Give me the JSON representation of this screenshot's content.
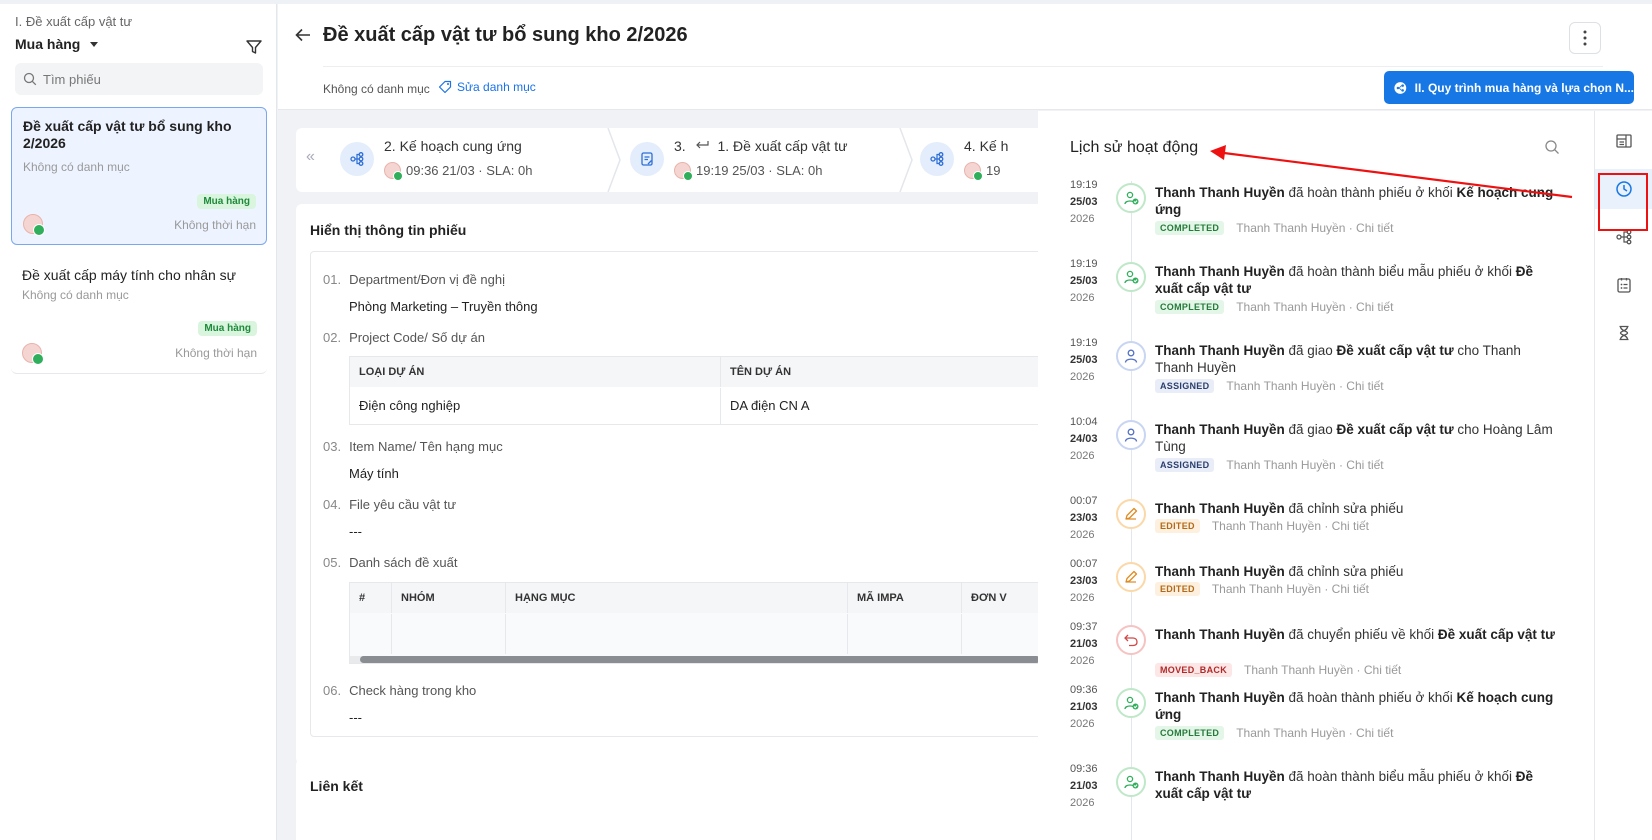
{
  "sidebar": {
    "crumb": "I. Đề xuất cấp vật tư",
    "title": "Mua hàng",
    "search_placeholder": "Tìm phiếu",
    "tickets": [
      {
        "title": "Đề xuất cấp vật tư bổ sung kho 2/2026",
        "category": "Không có danh mục",
        "badge": "Mua hàng",
        "deadline": "Không thời hạn"
      },
      {
        "title": "Đề xuất cấp máy tính cho nhân sự",
        "category": "Không có danh mục",
        "badge": "Mua hàng",
        "deadline": "Không thời hạn"
      }
    ]
  },
  "header": {
    "title": "Đề xuất cấp vật tư bổ sung kho 2/2026",
    "category": "Không có danh mục",
    "edit_category": "Sửa danh mục",
    "process_button": "II. Quy trình mua hàng và lựa chọn N..."
  },
  "steps": [
    {
      "name": "2. Kế hoạch cung ứng",
      "meta": "09:36 21/03 · SLA: 0h"
    },
    {
      "name_prefix": "3.",
      "name": "1. Đề xuất cấp vật tư",
      "meta": "19:19 25/03 · SLA: 0h"
    },
    {
      "name": "4. Kế h",
      "meta": "19"
    }
  ],
  "info": {
    "title": "Hiển thị thông tin phiếu",
    "fields": [
      {
        "num": "01.",
        "label": "Department/Đơn vị đề nghị",
        "value": "Phòng Marketing – Truyền thông"
      },
      {
        "num": "02.",
        "label": "Project Code/ Số dự án"
      },
      {
        "num": "03.",
        "label": "Item Name/ Tên hạng mục",
        "value": "Máy tính"
      },
      {
        "num": "04.",
        "label": "File yêu cầu vật tư",
        "value": "---"
      },
      {
        "num": "05.",
        "label": "Danh sách đề xuất"
      },
      {
        "num": "06.",
        "label": "Check hàng trong kho",
        "value": "---"
      }
    ],
    "project_table": {
      "headers": [
        "LOẠI DỰ ÁN",
        "TÊN DỰ ÁN"
      ],
      "rows": [
        [
          "Điện công nghiệp",
          "DA điện CN A"
        ]
      ]
    },
    "proposal_table": {
      "headers": [
        "#",
        "NHÓM",
        "HẠNG MỤC",
        "MÃ IMPA",
        "ĐƠN V"
      ]
    }
  },
  "links": {
    "title": "Liên kết"
  },
  "activity": {
    "title": "Lịch sử hoạt động",
    "items": [
      {
        "time": "19:19",
        "day": "25/03",
        "year": "2026",
        "type": "green",
        "actor": "Thanh Thanh Huyền",
        "action": " đã hoàn thành phiếu ở khối ",
        "target": "Kế hoạch cung ứng",
        "tail": "",
        "status": "COMPLETED",
        "status_class": "completed",
        "by": "Thanh Thanh Huyền · Chi tiết"
      },
      {
        "time": "19:19",
        "day": "25/03",
        "year": "2026",
        "type": "green",
        "actor": "Thanh Thanh Huyền",
        "action": " đã hoàn thành biểu mẫu phiếu ở khối ",
        "target": "Đề xuất cấp vật tư",
        "tail": "",
        "status": "COMPLETED",
        "status_class": "completed",
        "by": "Thanh Thanh Huyền · Chi tiết"
      },
      {
        "time": "19:19",
        "day": "25/03",
        "year": "2026",
        "type": "blue",
        "actor": "Thanh Thanh Huyền",
        "action": " đã giao ",
        "target": "Đề xuất cấp vật tư",
        "tail": " cho Thanh Thanh Huyền",
        "status": "ASSIGNED",
        "status_class": "assigned",
        "by": "Thanh Thanh Huyền · Chi tiết"
      },
      {
        "time": "10:04",
        "day": "24/03",
        "year": "2026",
        "type": "blue",
        "actor": "Thanh Thanh Huyền",
        "action": " đã giao ",
        "target": "Đề xuất cấp vật tư",
        "tail": " cho Hoàng Lâm Tùng",
        "status": "ASSIGNED",
        "status_class": "assigned",
        "by": "Thanh Thanh Huyền · Chi tiết"
      },
      {
        "time": "00:07",
        "day": "23/03",
        "year": "2026",
        "type": "orange",
        "actor": "Thanh Thanh Huyền",
        "action": " đã chỉnh sửa phiếu",
        "target": "",
        "tail": "",
        "status": "EDITED",
        "status_class": "edited",
        "by": "Thanh Thanh Huyền · Chi tiết"
      },
      {
        "time": "00:07",
        "day": "23/03",
        "year": "2026",
        "type": "orange",
        "actor": "Thanh Thanh Huyền",
        "action": " đã chỉnh sửa phiếu",
        "target": "",
        "tail": "",
        "status": "EDITED",
        "status_class": "edited",
        "by": "Thanh Thanh Huyền · Chi tiết"
      },
      {
        "time": "09:37",
        "day": "21/03",
        "year": "2026",
        "type": "red",
        "actor": "Thanh Thanh Huyền",
        "action": " đã chuyển phiếu về khối ",
        "target": "Đề xuất cấp vật tư",
        "tail": "",
        "status": "MOVED_BACK",
        "status_class": "moved",
        "by": "Thanh Thanh Huyền · Chi tiết"
      },
      {
        "time": "09:36",
        "day": "21/03",
        "year": "2026",
        "type": "green",
        "actor": "Thanh Thanh Huyền",
        "action": " đã hoàn thành phiếu ở khối ",
        "target": "Kế hoạch cung ứng",
        "tail": "",
        "status": "COMPLETED",
        "status_class": "completed",
        "by": "Thanh Thanh Huyền · Chi tiết"
      },
      {
        "time": "09:36",
        "day": "21/03",
        "year": "2026",
        "type": "green",
        "actor": "Thanh Thanh Huyền",
        "action": " đã hoàn thành biểu mẫu phiếu ở khối ",
        "target": "Đề xuất cấp vật tư",
        "tail": "",
        "status": "",
        "status_class": "completed",
        "by": ""
      }
    ]
  },
  "rail": {
    "icons": [
      "layout-icon",
      "clock-history-icon",
      "workflow-icon",
      "checklist-icon",
      "hourglass-icon"
    ]
  },
  "colors": {
    "primary": "#1677e5",
    "annotation": "#e11111"
  }
}
